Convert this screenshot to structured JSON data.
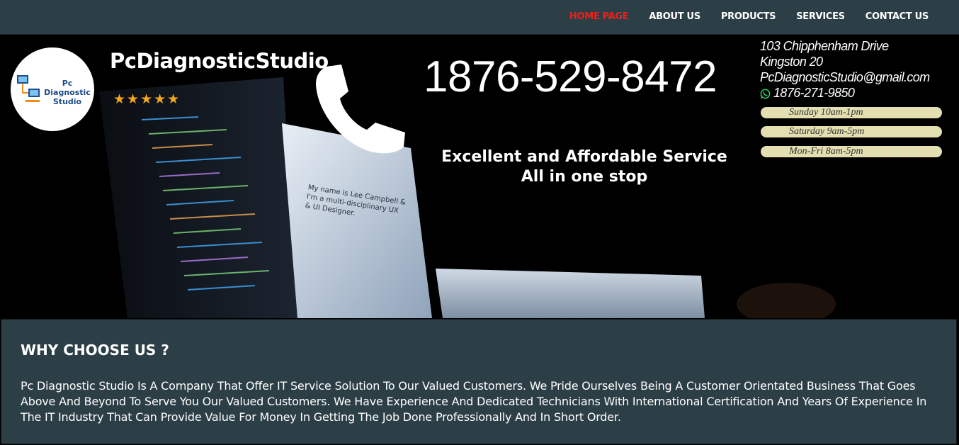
{
  "nav": {
    "items": [
      {
        "label": "HOME PAGE",
        "active": true
      },
      {
        "label": "ABOUT US"
      },
      {
        "label": "PRODUCTS"
      },
      {
        "label": "SERVICES"
      },
      {
        "label": "CONTACT US"
      }
    ]
  },
  "hero": {
    "logo_text": "Pc Diagnostic Studio",
    "brand": "PcDiagnosticStudio",
    "rating_stars": "★★★★★",
    "phone_main": "1876-529-8472",
    "tagline_line1": "Excellent and Affordable Service",
    "tagline_line2": "All in one stop",
    "background_screen_text": "My name is Lee Campbell & I'm a multi-disciplinary UX & UI Designer."
  },
  "contact": {
    "address_line1": "103 Chipphenham Drive",
    "address_line2": "Kingston 20",
    "email": "PcDiagnosticStudio@gmail.com",
    "whatsapp": "1876-271-9850",
    "hours": [
      "Sunday 10am-1pm",
      "Saturday 9am-5pm",
      "Mon-Fri 8am-5pm"
    ]
  },
  "why": {
    "heading": "WHY CHOOSE US ?",
    "body": "Pc Diagnostic Studio Is A Company That Offer IT Service Solution To Our Valued Customers. We Pride Ourselves Being A Customer Orientated Business That Goes Above And Beyond To Serve You Our Valued Customers. We Have Experience And Dedicated Technicians With International Certification And Years Of Experience In The IT Industry That Can Provide Value For Money In Getting The Job Done Professionally And In Short Order."
  },
  "colors": {
    "nav_bg": "#2c3e46",
    "active": "#e8231b",
    "star": "#f5a623",
    "hours_pill": "#e3dfb0"
  }
}
